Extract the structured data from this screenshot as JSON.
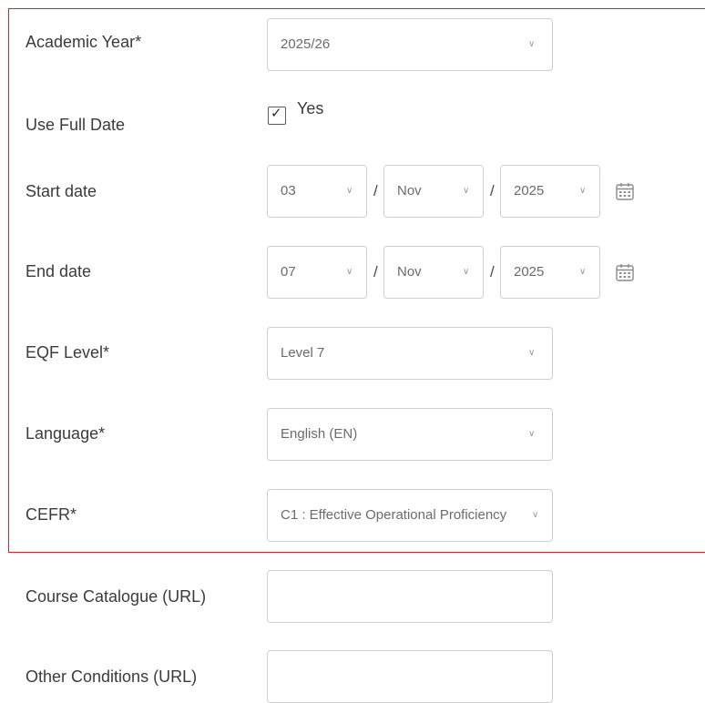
{
  "form": {
    "academic_year": {
      "label": "Academic Year*",
      "value": "2025/26"
    },
    "use_full_date": {
      "label": "Use Full Date",
      "checkbox_label": "Yes",
      "checked": true
    },
    "start_date": {
      "label": "Start date",
      "day": "03",
      "month": "Nov",
      "year": "2025"
    },
    "end_date": {
      "label": "End date",
      "day": "07",
      "month": "Nov",
      "year": "2025"
    },
    "date_separator": "/",
    "eqf_level": {
      "label": "EQF Level*",
      "value": "Level 7"
    },
    "language": {
      "label": "Language*",
      "value": "English (EN)"
    },
    "cefr": {
      "label": "CEFR*",
      "value": "C1 : Effective Operational Proficiency"
    },
    "course_catalogue": {
      "label": "Course Catalogue (URL)",
      "value": ""
    },
    "other_conditions": {
      "label": "Other Conditions (URL)",
      "value": ""
    }
  },
  "icons": {
    "dropdown": "chevron-down-icon",
    "calendar": "calendar-icon",
    "check": "checkmark-icon"
  },
  "colors": {
    "highlight_border": "#e41f26",
    "field_border": "#cfcfcf"
  }
}
